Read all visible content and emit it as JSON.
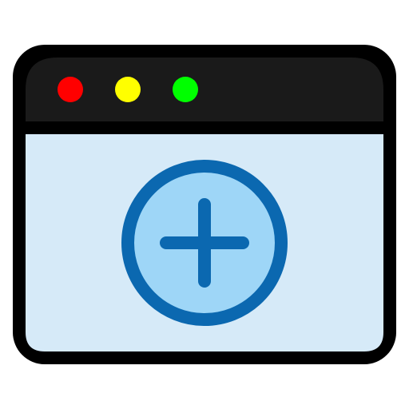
{
  "icon": {
    "type": "browser-window-add-icon",
    "window": {
      "frame_color": "#000000",
      "titlebar_color": "#1a1a1a",
      "content_color": "#d6eaf8"
    },
    "titlebar_dots": [
      {
        "name": "close-dot",
        "color": "#ff0000"
      },
      {
        "name": "minimize-dot",
        "color": "#ffff00"
      },
      {
        "name": "maximize-dot",
        "color": "#00ff00"
      }
    ],
    "add_button": {
      "icon": "plus-circle-icon",
      "fill_color": "#9ed6f7",
      "stroke_color": "#0b68b0"
    }
  }
}
